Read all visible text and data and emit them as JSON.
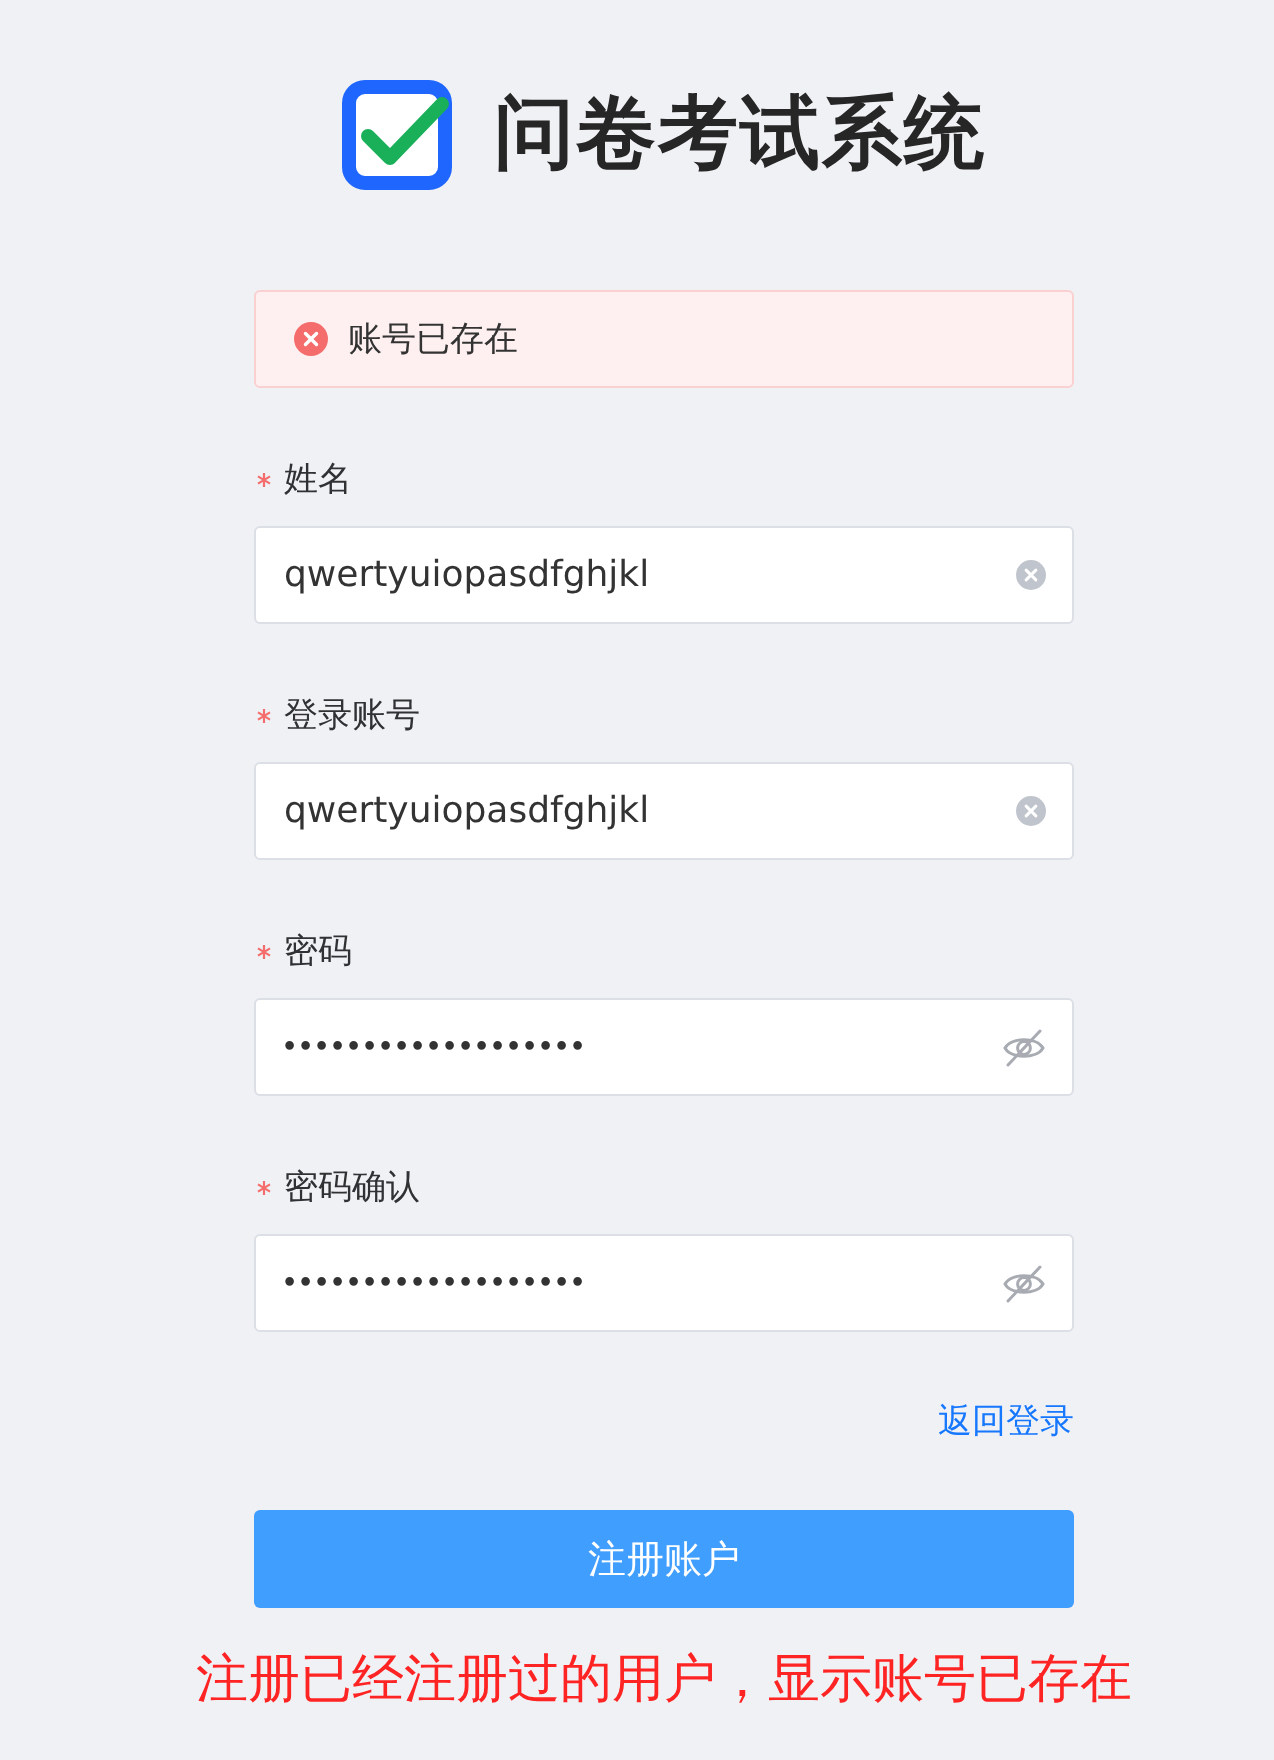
{
  "header": {
    "title": "问卷考试系统"
  },
  "alert": {
    "message": "账号已存在"
  },
  "fields": [
    {
      "label": "姓名",
      "required": true,
      "kind": "text",
      "value": "qwertyuiopasdfghjkl"
    },
    {
      "label": "登录账号",
      "required": true,
      "kind": "text",
      "value": "qwertyuiopasdfghjkl"
    },
    {
      "label": "密码",
      "required": true,
      "kind": "password",
      "value": "•••••••••••••••••••"
    },
    {
      "label": "密码确认",
      "required": true,
      "kind": "password",
      "value": "•••••••••••••••••••"
    }
  ],
  "back_link": "返回登录",
  "submit_button": "注册账户",
  "caption": "注册已经注册过的用户，显示账号已存在"
}
